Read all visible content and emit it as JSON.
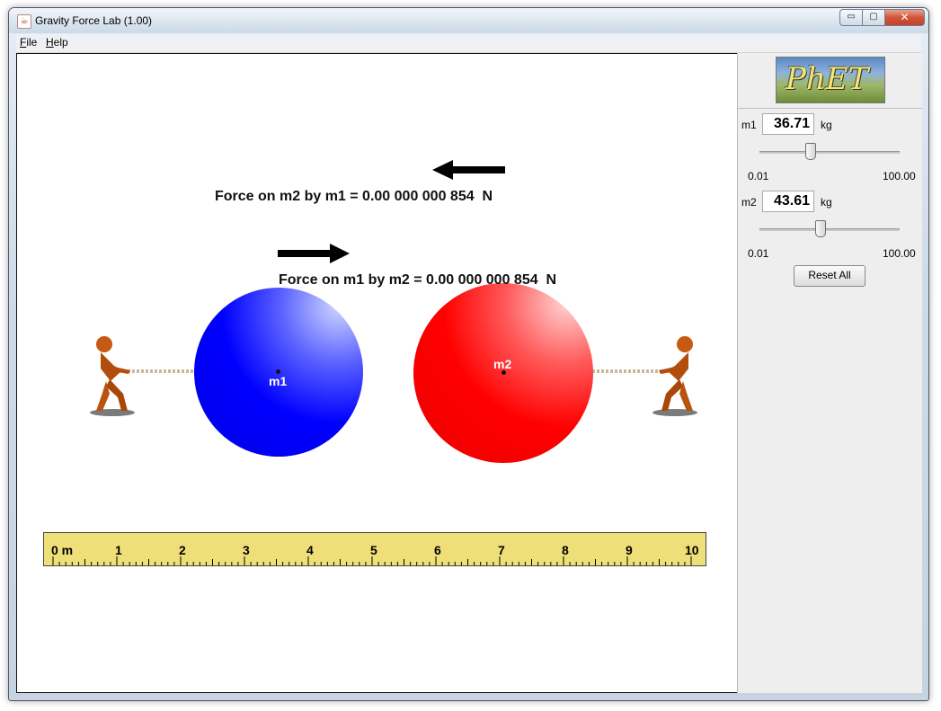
{
  "window": {
    "title": "Gravity Force Lab (1.00)",
    "minimize_symbol": "▭",
    "maximize_symbol": "▢",
    "close_symbol": "✕",
    "app_icon": "java-cup-icon"
  },
  "menu": {
    "file": {
      "underline": "F",
      "rest": "ile"
    },
    "help": {
      "underline": "H",
      "rest": "elp"
    }
  },
  "play_area": {
    "force_m2_by_m1": "Force on m2 by m1 = 0.00 000 000 854  N",
    "force_m1_by_m2": "Force on m1 by m2 = 0.00 000 000 854  N",
    "m1_label": "m1",
    "m2_label": "m2",
    "m1_color": "#0000ff",
    "m2_color": "#ff0000",
    "ruler": {
      "numbers": [
        "0 m",
        "1",
        "2",
        "3",
        "4",
        "5",
        "6",
        "7",
        "8",
        "9",
        "10"
      ]
    }
  },
  "control_panel": {
    "logo_text": "PhET",
    "m1": {
      "label": "m1",
      "value": "36.71",
      "unit": "kg",
      "min_label": "0.01",
      "max_label": "100.00",
      "fraction": 0.3671
    },
    "m2": {
      "label": "m2",
      "value": "43.61",
      "unit": "kg",
      "min_label": "0.01",
      "max_label": "100.00",
      "fraction": 0.4361
    },
    "reset_label": "Reset All"
  }
}
